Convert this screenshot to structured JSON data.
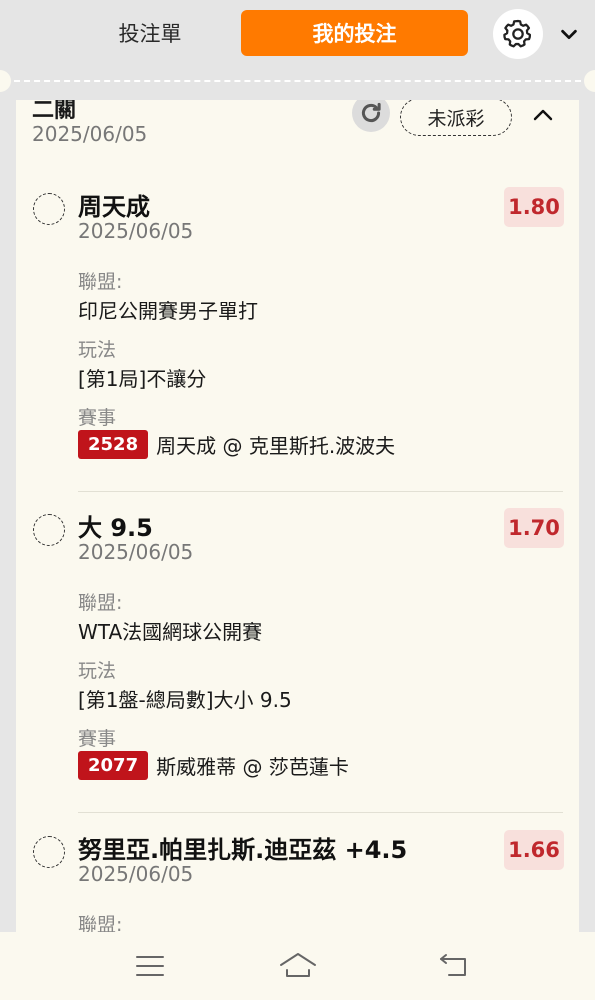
{
  "header": {
    "tab_slip": "投注單",
    "tab_mybets": "我的投注"
  },
  "group": {
    "title": "二關",
    "date": "2025/06/05",
    "status": "未派彩"
  },
  "bets": [
    {
      "selection": "周天成",
      "date": "2025/06/05",
      "odds": "1.80",
      "league_label": "聯盟:",
      "league": "印尼公開賽男子單打",
      "market_label": "玩法",
      "market": "[第1局]不讓分",
      "event_label": "賽事",
      "event_id": "2528",
      "event": "周天成 @ 克里斯托.波波夫"
    },
    {
      "selection": "大 9.5",
      "date": "2025/06/05",
      "odds": "1.70",
      "league_label": "聯盟:",
      "league": "WTA法國網球公開賽",
      "market_label": "玩法",
      "market": "[第1盤-總局數]大小 9.5",
      "event_label": "賽事",
      "event_id": "2077",
      "event": "斯威雅蒂 @ 莎芭蓮卡"
    },
    {
      "selection": "努里亞.帕里扎斯.迪亞茲 +4.5",
      "date": "2025/06/05",
      "odds": "1.66",
      "league_label": "聯盟:"
    }
  ],
  "icons": {
    "settings": "gear-icon",
    "dropdown": "chevron-down-icon",
    "refresh": "refresh-icon",
    "collapse": "chevron-up-icon",
    "menu": "menu-icon",
    "home": "home-icon",
    "back": "back-icon"
  },
  "colors": {
    "accent": "#ff7a00",
    "odds_text": "#c0282d",
    "odds_bg": "#f8e0dc",
    "event_badge": "#c0141b",
    "panel_bg": "#fbf9ef"
  }
}
